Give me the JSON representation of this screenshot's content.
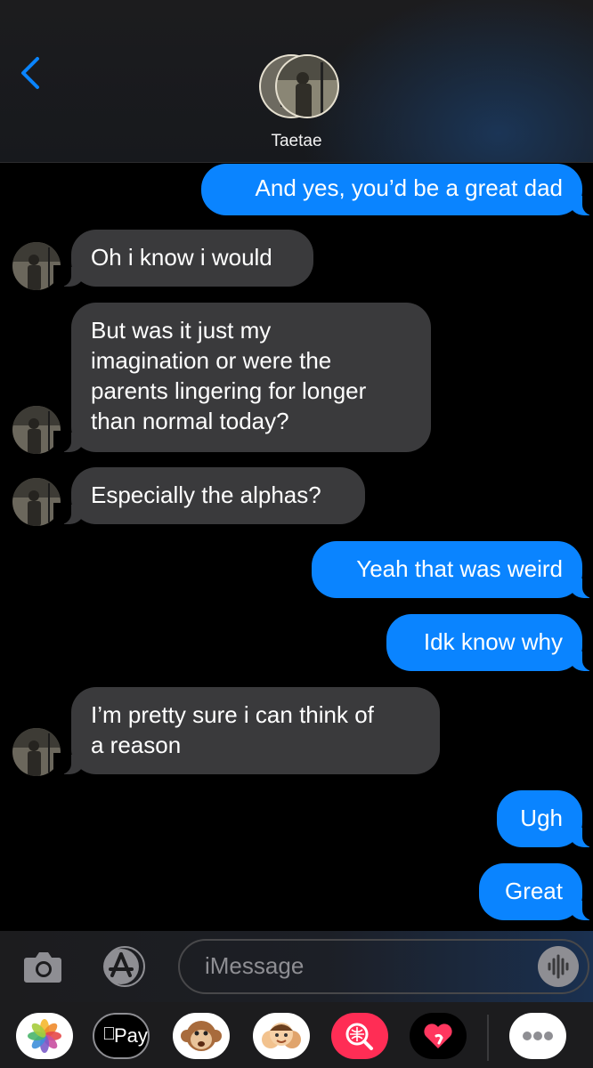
{
  "header": {
    "contact_name": "Taetae",
    "back_icon": "chevron-left-icon",
    "accent": "#0a84ff"
  },
  "messages": [
    {
      "direction": "sent",
      "text": "And yes, you’d be a great dad"
    },
    {
      "direction": "received",
      "text": "Oh i know i would"
    },
    {
      "direction": "received",
      "text": "But was it just my\nimagination or were the\nparents lingering for longer\nthan normal today?"
    },
    {
      "direction": "received",
      "text": "Especially the alphas?"
    },
    {
      "direction": "sent",
      "text": "Yeah that was weird"
    },
    {
      "direction": "sent",
      "text": "Idk know why"
    },
    {
      "direction": "received",
      "text": "I’m pretty sure i can think of\na reason"
    },
    {
      "direction": "sent",
      "text": "Ugh"
    },
    {
      "direction": "sent",
      "text": "Great"
    }
  ],
  "input": {
    "placeholder": "iMessage",
    "camera_icon": "camera-icon",
    "appstore_icon": "app-store-icon",
    "audio_icon": "audio-waveform-icon"
  },
  "app_drawer": {
    "apple_pay_label": "Pay",
    "apps": [
      "photos-icon",
      "apple-pay-icon",
      "monkey-animoji-icon",
      "memoji-icon",
      "image-search-icon",
      "digital-touch-heart-icon",
      "more-icon"
    ]
  },
  "colors": {
    "sent_bubble": "#0a84ff",
    "received_bubble": "#3a3a3c",
    "background": "#000000"
  }
}
